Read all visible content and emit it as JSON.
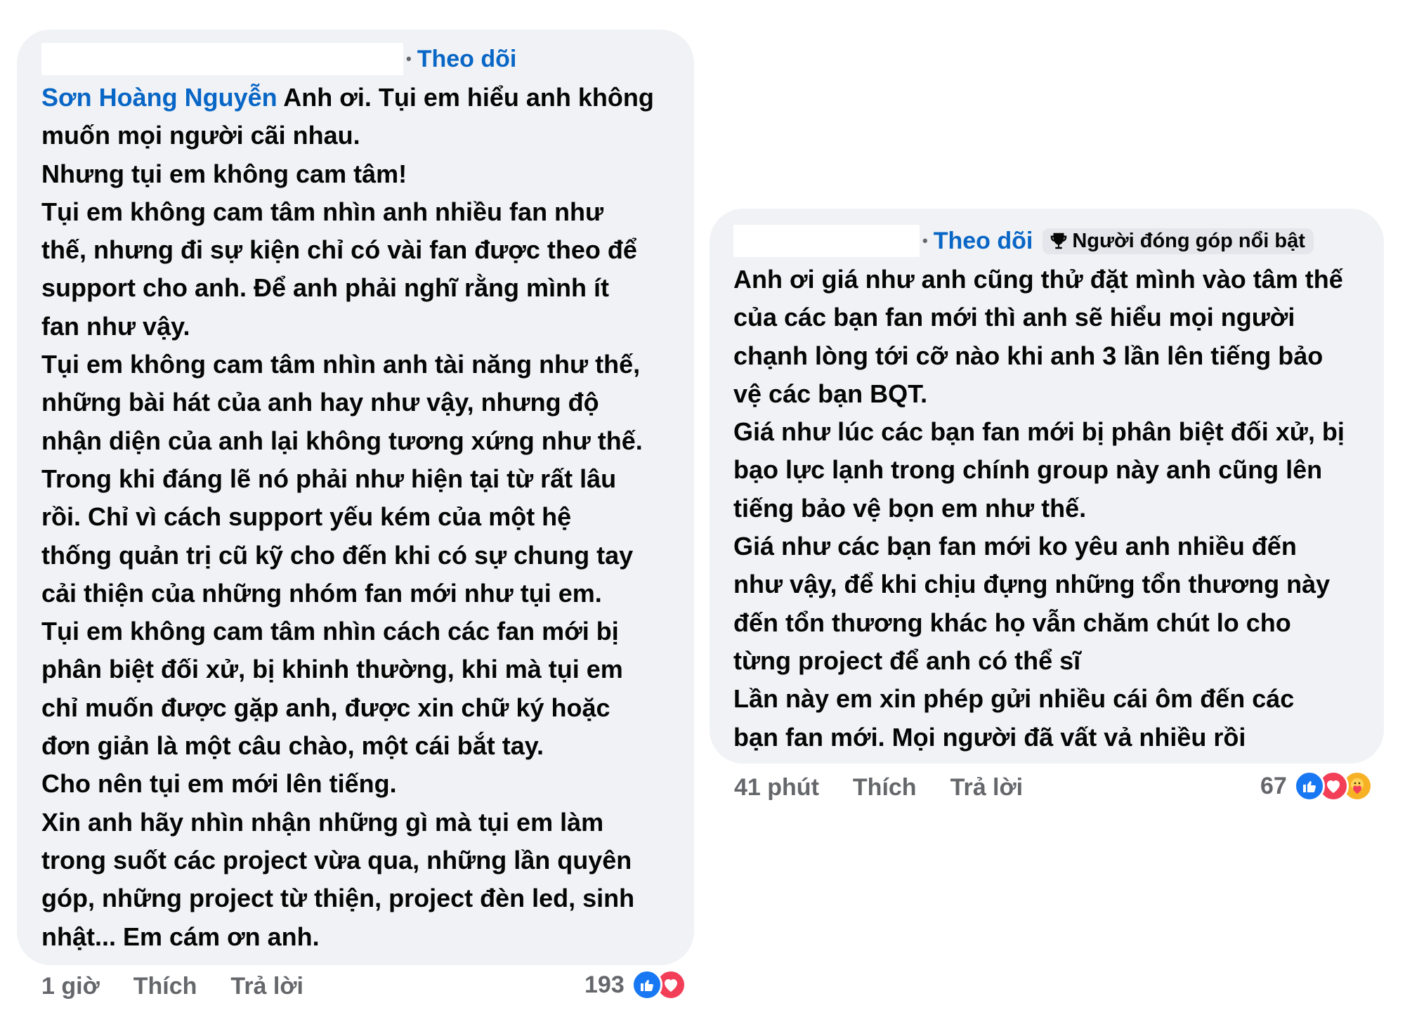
{
  "comment1": {
    "follow_label": "Theo dõi",
    "mention": "Sơn Hoàng Nguyễn",
    "lines": [
      " Anh ơi. Tụi em hiểu anh không",
      "muốn mọi người cãi nhau.",
      "Nhưng tụi em không cam tâm!",
      "Tụi em không cam tâm nhìn anh nhiều fan như",
      "thế, nhưng đi sự kiện chỉ có vài fan được theo để",
      "support cho anh. Để anh phải nghĩ rằng mình ít",
      "fan như vậy.",
      "Tụi em không cam tâm nhìn anh tài năng như thế,",
      "những bài hát của anh hay như vậy, nhưng độ",
      "nhận diện của anh lại không tương xứng như thế.",
      "Trong khi đáng lẽ nó phải như hiện tại từ rất lâu",
      "rồi. Chỉ vì cách support yếu kém của một hệ",
      "thống quản trị cũ kỹ cho đến khi có sự chung tay",
      "cải thiện của những nhóm fan mới như tụi em.",
      "Tụi em không cam tâm nhìn cách các fan mới bị",
      "phân biệt đối xử, bị khinh thường, khi mà tụi em",
      "chỉ muốn được gặp anh, được xin chữ ký hoặc",
      "đơn giản là một câu chào, một cái bắt tay.",
      "Cho nên tụi em mới lên tiếng.",
      "Xin anh hãy nhìn nhận những gì mà tụi em làm",
      "trong suốt các project vừa qua, những lần quyên",
      "góp, những project từ thiện, project đèn led, sinh",
      "nhật... Em cám ơn anh."
    ],
    "time": "1 giờ",
    "like_label": "Thích",
    "reply_label": "Trả lời",
    "reaction_count": "193",
    "reactions": [
      "like-icon",
      "love-icon"
    ]
  },
  "comment2": {
    "follow_label": "Theo dõi",
    "badge_label": "Người đóng góp nổi bật",
    "lines": [
      "Anh ơi giá như anh cũng thử đặt mình vào tâm thế",
      "của các bạn fan mới thì anh sẽ hiểu mọi người",
      "chạnh lòng tới cỡ nào khi anh 3 lần lên tiếng bảo",
      "vệ các bạn BQT.",
      "Giá như lúc các bạn fan mới bị phân biệt đối xử, bị",
      "bạo lực lạnh trong chính group này anh cũng lên",
      "tiếng bảo vệ bọn em như thế.",
      "Giá như các bạn fan mới ko yêu anh nhiều đến",
      "như vậy, để khi chịu đựng những tổn thương này",
      "đến tổn thương khác họ vẫn chăm chút lo cho",
      "từng project để anh có thể sĩ",
      "Lần này em xin phép gửi nhiều cái ôm đến các",
      "bạn fan mới. Mọi người đã vất vả nhiều rồi"
    ],
    "time": "41 phút",
    "like_label": "Thích",
    "reply_label": "Trả lời",
    "reaction_count": "67",
    "reactions": [
      "like-icon",
      "love-icon",
      "care-icon"
    ]
  }
}
